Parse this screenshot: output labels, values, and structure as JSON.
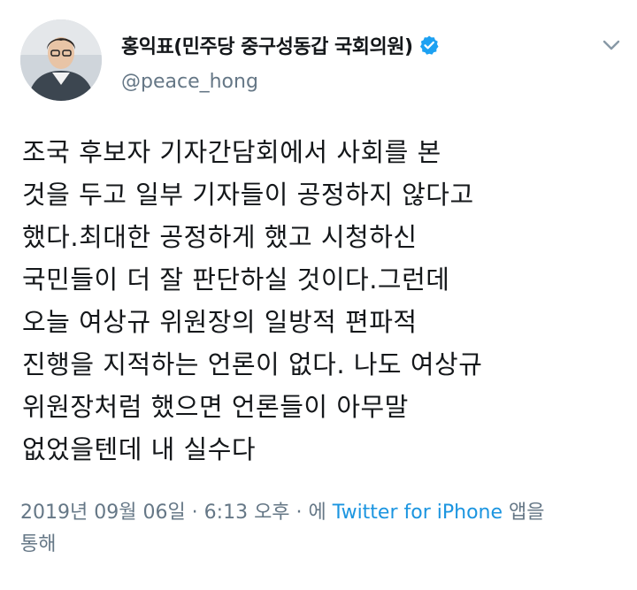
{
  "user": {
    "display_name": "홍익표(민주당 중구성동갑 국회의원)",
    "handle": "@peace_hong",
    "verified_icon": "verified-badge-icon",
    "verified_color": "#1da1f2"
  },
  "menu": {
    "icon": "chevron-down-icon"
  },
  "tweet": {
    "lines": [
      "조국 후보자 기자간담회에서 사회를 본",
      "것을 두고 일부 기자들이 공정하지 않다고",
      "했다.최대한 공정하게 했고 시청하신",
      "국민들이 더 잘 판단하실 것이다.그런데",
      "오늘 여상규 위원장의 일방적 편파적",
      "진행을 지적하는 언론이 없다. 나도 여상규",
      "위원장처럼 했으면 언론들이 아무말",
      "없었을텐데 내 실수다"
    ]
  },
  "meta": {
    "date": "2019년 09월 06일",
    "sep1": " · ",
    "time": "6:13 오후",
    "sep2": " · 에 ",
    "source": "Twitter for iPhone",
    "suffix_line1": " 앱을",
    "suffix_line2": "통해"
  },
  "colors": {
    "text": "#14171a",
    "secondary": "#657786",
    "link": "#1b95e0"
  }
}
